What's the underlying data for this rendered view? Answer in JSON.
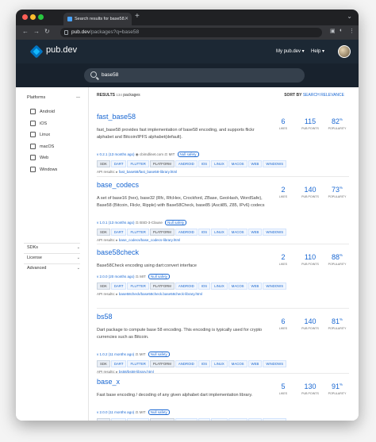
{
  "browser": {
    "tab_title": "Search results for base58.",
    "url_host": "pub.dev",
    "url_path": "/packages?q=base58"
  },
  "site": {
    "logo_text": "pub.dev",
    "nav_my_pubdev": "My pub.dev ▾",
    "nav_help": "Help ▾",
    "search_query": "base58"
  },
  "sidebar": {
    "platforms_label": "Platforms",
    "platforms": [
      "Android",
      "iOS",
      "Linux",
      "macOS",
      "Web",
      "Windows"
    ],
    "sdks_label": "SDKs",
    "license_label": "License",
    "advanced_label": "Advanced"
  },
  "results": {
    "label": "RESULTS",
    "count": "134",
    "suffix": "packages",
    "sort_label": "SORT BY",
    "sort_value": "SEARCH RELEVANCE"
  },
  "score_labels": {
    "likes": "LIKES",
    "points": "PUB POINTS",
    "popularity": "POPULARITY"
  },
  "packages": [
    {
      "name": "fast_base58",
      "desc": "fast_base58 provides fast implementation of base58 encoding, and supports flickr alphabet and Bitcoin/IPFS alphabet(default).",
      "version": "v 0.2.1 (13 months ago)",
      "publisher": "cbimdlinet.com",
      "license": "MIT",
      "null_safety": "Null safety",
      "sdk_tags": [
        "SDK",
        "DART",
        "FLUTTER"
      ],
      "platform_tags": [
        "PLATFORM",
        "ANDROID",
        "IOS",
        "LINUX",
        "MACOS",
        "WEB",
        "WINDOWS"
      ],
      "api_label": "API results:",
      "api_link": "fast_base58/fast_base58-library.html",
      "likes": "6",
      "points": "115",
      "popularity": "82"
    },
    {
      "name": "base_codecs",
      "desc": "A set of base16 (hex), base32 (Rfc, RfcHex, Crockford, ZBase, GeoHash, WordSafe), Base58 (Bitcoin, Flickr, Ripple) with Base58Check, base85 (Ascii85, Z85, IPv6) codecs",
      "version": "v 1.0.1 (13 months ago)",
      "publisher": "",
      "license": "BSD-3-Clause",
      "null_safety": "Null safety",
      "sdk_tags": [
        "SDK",
        "DART",
        "FLUTTER"
      ],
      "platform_tags": [
        "PLATFORM",
        "ANDROID",
        "IOS",
        "LINUX",
        "MACOS",
        "WEB",
        "WINDOWS"
      ],
      "api_label": "API results:",
      "api_link": "base_codecs/base_codecs-library.html",
      "likes": "2",
      "points": "140",
      "popularity": "73"
    },
    {
      "name": "base58check",
      "desc": "Base58Check encoding using dart:convert interface",
      "version": "v 2.0.0 (20 months ago)",
      "publisher": "",
      "license": "MIT",
      "null_safety": "Null safety",
      "sdk_tags": [
        "SDK",
        "DART",
        "FLUTTER"
      ],
      "platform_tags": [
        "PLATFORM",
        "ANDROID",
        "IOS",
        "LINUX",
        "MACOS",
        "WEB",
        "WINDOWS"
      ],
      "api_label": "API results:",
      "api_link": "base58check/base58check.base58check-library.html",
      "likes": "2",
      "points": "110",
      "popularity": "88"
    },
    {
      "name": "bs58",
      "desc": "Dart package to compute base 58 encoding. This encoding is typically used for crypto currencies such as Bitcoin.",
      "version": "v 1.0.2 (11 months ago)",
      "publisher": "",
      "license": "MIT",
      "null_safety": "Null safety",
      "sdk_tags": [
        "SDK",
        "DART",
        "FLUTTER"
      ],
      "platform_tags": [
        "PLATFORM",
        "ANDROID",
        "IOS",
        "LINUX",
        "MACOS",
        "WEB",
        "WINDOWS"
      ],
      "api_label": "API results:",
      "api_link": "bs58/bs58-library.html",
      "likes": "6",
      "points": "140",
      "popularity": "81"
    },
    {
      "name": "base_x",
      "desc": "Fast base encoding / decoding of any given alphabet dart implementation library.",
      "version": "v 2.0.0 (11 months ago)",
      "publisher": "",
      "license": "MIT",
      "null_safety": "Null safety",
      "sdk_tags": [
        "SDK",
        "DART",
        "FLUTTER"
      ],
      "platform_tags": [
        "PLATFORM",
        "ANDROID",
        "IOS",
        "LINUX",
        "MACOS",
        "WEB",
        "WINDOWS"
      ],
      "api_label": "",
      "api_link": "",
      "likes": "5",
      "points": "130",
      "popularity": "91"
    }
  ]
}
